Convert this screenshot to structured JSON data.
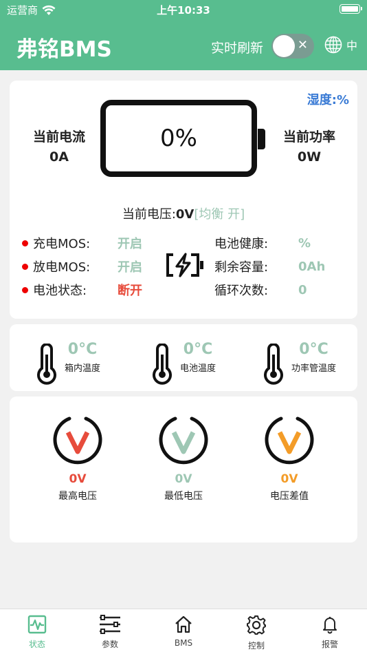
{
  "status_bar": {
    "carrier": "运营商",
    "time": "上午10:33"
  },
  "header": {
    "title": "弗铭BMS",
    "refresh_label": "实时刷新",
    "lang": "中",
    "toggle_on": false
  },
  "main": {
    "humidity": "湿度:%",
    "current_label": "当前电流",
    "current_value": "0A",
    "power_label": "当前功率",
    "power_value": "0W",
    "battery_percent": "0%",
    "voltage_label": "当前电压:",
    "voltage_value": "0V",
    "balance_text": "[均衡 开]",
    "mos": [
      {
        "label": "充电MOS:",
        "value": "开启",
        "status": "ok"
      },
      {
        "label": "放电MOS:",
        "value": "开启",
        "status": "ok"
      },
      {
        "label": "电池状态:",
        "value": "断开",
        "status": "alert"
      }
    ],
    "info": [
      {
        "label": "电池健康:",
        "value": "%"
      },
      {
        "label": "剩余容量:",
        "value": "0Ah"
      },
      {
        "label": "循环次数:",
        "value": "0"
      }
    ]
  },
  "temperatures": [
    {
      "value": "0°C",
      "label": "箱内温度"
    },
    {
      "value": "0°C",
      "label": "电池温度"
    },
    {
      "value": "0°C",
      "label": "功率管温度"
    }
  ],
  "voltages": [
    {
      "value": "0V",
      "label": "最高电压",
      "color": "#e74c3c"
    },
    {
      "value": "0V",
      "label": "最低电压",
      "color": "#9ec7b4"
    },
    {
      "value": "0V",
      "label": "电压差值",
      "color": "#f39c28"
    }
  ],
  "tabs": [
    {
      "label": "状态",
      "icon": "pulse-icon",
      "active": true
    },
    {
      "label": "参数",
      "icon": "list-icon",
      "active": false
    },
    {
      "label": "BMS",
      "icon": "home-icon",
      "active": false
    },
    {
      "label": "控制",
      "icon": "gear-icon",
      "active": false
    },
    {
      "label": "报警",
      "icon": "bell-icon",
      "active": false
    }
  ],
  "colors": {
    "brand": "#58bd8f",
    "value_green": "#9ec7b4",
    "alert_red": "#e74c3c",
    "humidity_blue": "#3a7bd5"
  }
}
